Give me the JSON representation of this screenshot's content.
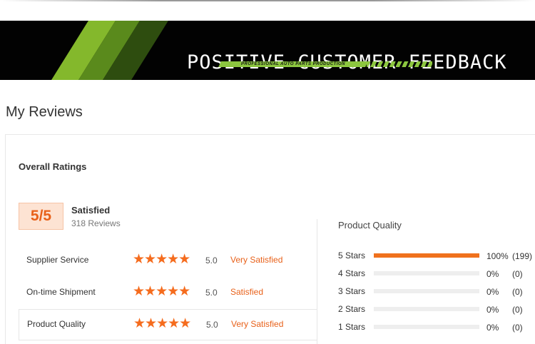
{
  "banner": {
    "title": "POSITIVE CUSTOMER FEEDBACK",
    "subtitle": "PROFESSIONAL AUTO PARTS PRODUCTION"
  },
  "page": {
    "title": "My Reviews"
  },
  "overall": {
    "heading": "Overall Ratings",
    "score": "5/5",
    "status": "Satisfied",
    "reviews": "318 Reviews"
  },
  "ratings": [
    {
      "label": "Supplier Service",
      "stars": "★★★★★",
      "value": "5.0",
      "text": "Very Satisfied"
    },
    {
      "label": "On-time Shipment",
      "stars": "★★★★★",
      "value": "5.0",
      "text": "Satisfied"
    },
    {
      "label": "Product Quality",
      "stars": "★★★★★",
      "value": "5.0",
      "text": "Very Satisfied"
    }
  ],
  "product_quality": {
    "title": "Product Quality",
    "rows": [
      {
        "label": "5 Stars",
        "pct": "100%",
        "count": "(199)",
        "fraction": 1.0
      },
      {
        "label": "4 Stars",
        "pct": "0%",
        "count": "(0)",
        "fraction": 0
      },
      {
        "label": "3 Stars",
        "pct": "0%",
        "count": "(0)",
        "fraction": 0
      },
      {
        "label": "2 Stars",
        "pct": "0%",
        "count": "(0)",
        "fraction": 0
      },
      {
        "label": "1 Stars",
        "pct": "0%",
        "count": "(0)",
        "fraction": 0
      }
    ]
  },
  "colors": {
    "accent": "#f0711d",
    "banner_green": "#8cc63f",
    "score_bg": "#fde3d3"
  }
}
